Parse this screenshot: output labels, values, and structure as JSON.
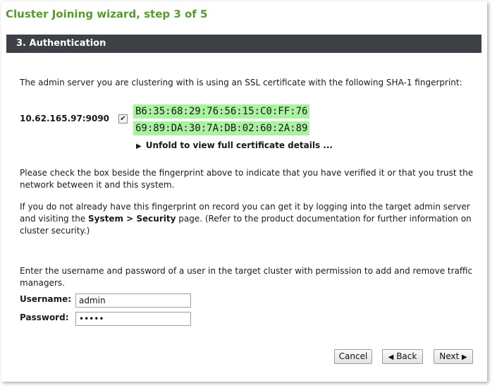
{
  "wizard": {
    "title": "Cluster Joining wizard, step 3 of 5"
  },
  "section": {
    "header": "3. Authentication"
  },
  "intro": "The admin server you are clustering with is using an SSL certificate with the following SHA-1 fingerprint:",
  "fingerprint": {
    "host": "10.62.165.97:9090",
    "checked": true,
    "check_glyph": "✔",
    "line1": "B6:35:68:29:76:56:15:C0:FF:76",
    "line2": "69:89:DA:30:7A:DB:02:60:2A:89",
    "unfold_arrow": "▶",
    "unfold_label": "Unfold to view full certificate details ...",
    "highlight_color": "#a9f2a0"
  },
  "paragraph_verify": "Please check the box beside the fingerprint above to indicate that you have verified it or that you trust the network between it and this system.",
  "paragraph_record": {
    "before": "If you do not already have this fingerprint on record you can get it by logging into the target admin server and visiting the ",
    "bold": "System > Security",
    "after": " page. (Refer to the product documentation for further information on cluster security.)"
  },
  "paragraph_credentials": "Enter the username and password of a user in the target cluster with permission to add and remove traffic managers.",
  "form": {
    "username_label": "Username:",
    "username_value": "admin",
    "password_label": "Password:",
    "password_value": "admin"
  },
  "buttons": {
    "cancel": "Cancel",
    "back_arrow": "◀",
    "back": "Back",
    "next": "Next",
    "next_arrow": "▶"
  },
  "colors": {
    "title": "#5a9a2a",
    "header_bg": "#3d4145"
  }
}
